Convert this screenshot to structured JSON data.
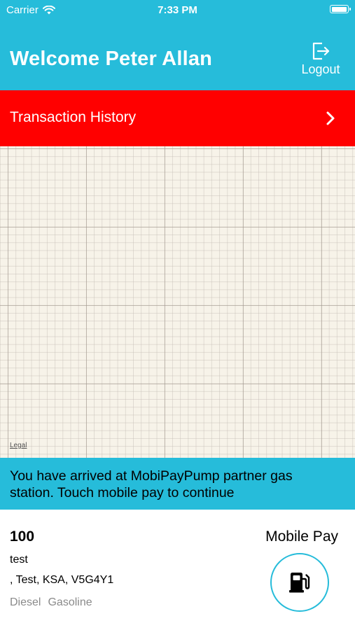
{
  "status_bar": {
    "carrier": "Carrier",
    "time": "7:33 PM",
    "icons": [
      "wifi-icon",
      "battery-icon"
    ],
    "battery_level": 1.0
  },
  "header": {
    "welcome": "Welcome Peter Allan",
    "logout_label": "Logout",
    "logout_icon": "logout-icon"
  },
  "history": {
    "label": "Transaction History",
    "chevron_icon": "chevron-right-icon"
  },
  "map": {
    "legal_label": "Legal"
  },
  "banner": {
    "message": "You have arrived at MobiPayPump partner gas station. Touch mobile pay to continue"
  },
  "station": {
    "id": "100",
    "name": "test",
    "address": ", Test, KSA, V5G4Y1",
    "fuel_types": [
      "Diesel",
      "Gasoline"
    ]
  },
  "mobile_pay": {
    "label": "Mobile Pay",
    "icon": "gas-pump-icon"
  },
  "colors": {
    "accent": "#26bcda",
    "history_bar": "#ff0000",
    "muted_text": "#8a8a8a",
    "map_background": "#f7f3e9"
  }
}
